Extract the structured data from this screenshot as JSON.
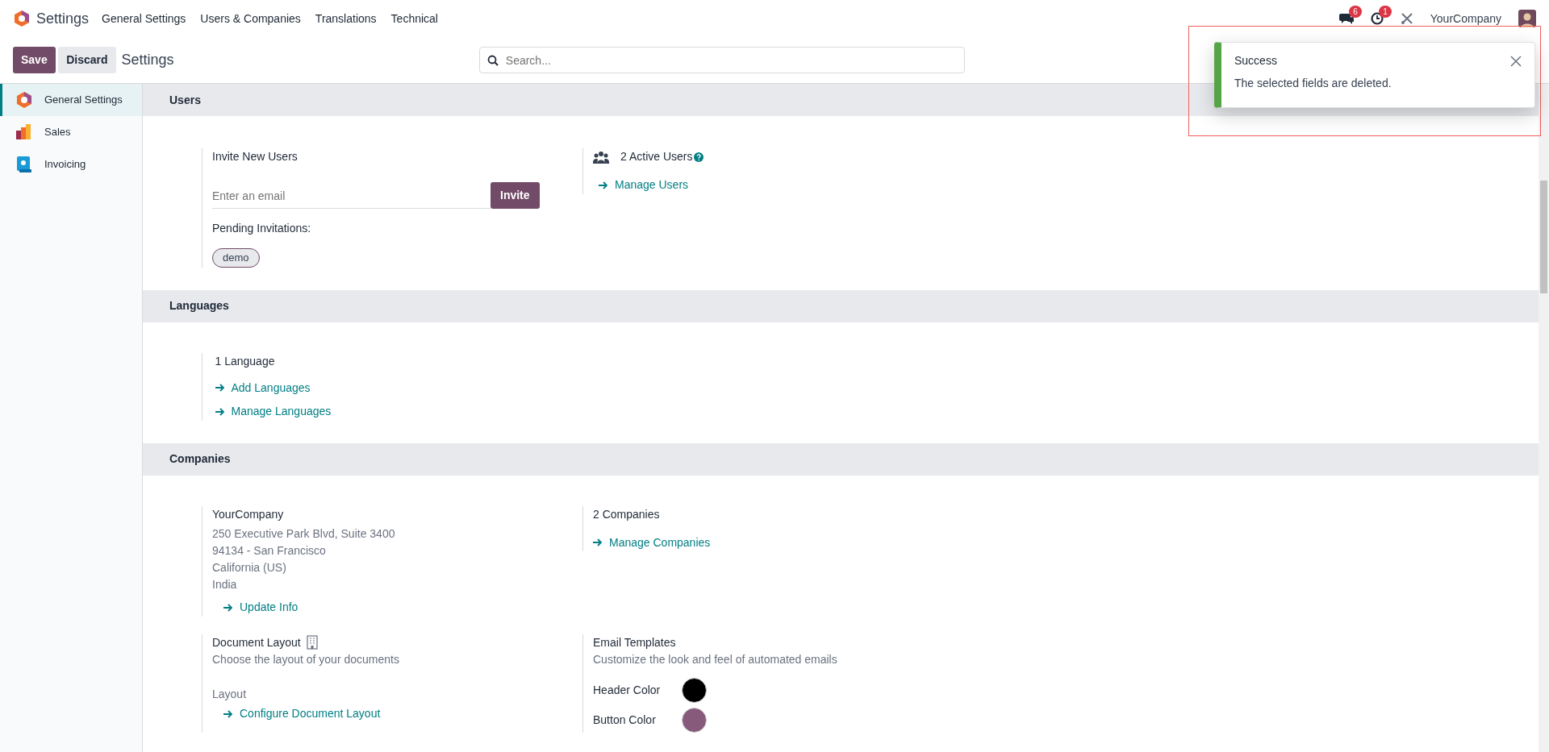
{
  "app": {
    "name": "Settings"
  },
  "menu": [
    {
      "label": "General Settings"
    },
    {
      "label": "Users & Companies"
    },
    {
      "label": "Translations"
    },
    {
      "label": "Technical"
    }
  ],
  "systray": {
    "messages_count": "6",
    "activities_count": "1",
    "company": "YourCompany"
  },
  "control_panel": {
    "buttons": [
      {
        "label": "Save",
        "kind": "primary"
      },
      {
        "label": "Discard",
        "kind": "secondary"
      }
    ],
    "breadcrumb": "Settings",
    "search": {
      "placeholder": "Search..."
    }
  },
  "sidebar": {
    "items": [
      {
        "label": "General Settings",
        "kind": "general",
        "selected": true
      },
      {
        "label": "Sales",
        "kind": "sales",
        "selected": false
      },
      {
        "label": "Invoicing",
        "kind": "invoicing",
        "selected": false
      }
    ]
  },
  "users": {
    "title": "Users",
    "invite": {
      "title": "Invite New Users",
      "placeholder": "Enter an email",
      "button": "Invite",
      "pending_label": "Pending Invitations:",
      "pending": [
        "demo"
      ]
    },
    "active_users": {
      "text": "2 Active Users",
      "link": "Manage Users"
    }
  },
  "languages": {
    "title": "Languages",
    "count": "1 Language",
    "links": [
      "Add Languages",
      "Manage Languages"
    ]
  },
  "companies": {
    "title": "Companies",
    "company": {
      "name": "YourCompany",
      "address": [
        "250 Executive Park Blvd, Suite 3400",
        "94134 - San Francisco",
        "California (US)",
        "India"
      ],
      "link": "Update Info"
    },
    "count": {
      "text": "2 Companies",
      "link": "Manage Companies"
    },
    "document_layout": {
      "title": "Document Layout",
      "description": "Choose the layout of your documents",
      "layout_label": "Layout",
      "link": "Configure Document Layout"
    },
    "email_templates": {
      "title": "Email Templates",
      "description": "Customize the look and feel of automated emails",
      "colors": [
        {
          "label": "Header Color",
          "color": "#000000"
        },
        {
          "label": "Button Color",
          "color": "#875a7b"
        }
      ]
    }
  },
  "toast": {
    "title": "Success",
    "message": "The selected fields are deleted."
  }
}
